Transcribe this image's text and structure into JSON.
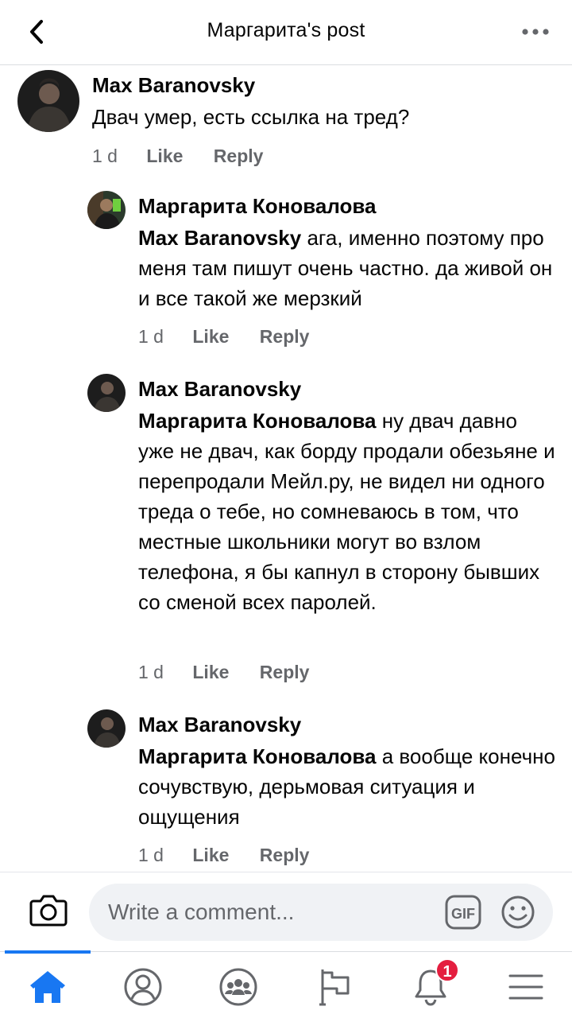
{
  "header": {
    "title": "Маргарита's post",
    "back_icon": "chevron-left-icon",
    "more_icon": "more-horizontal-icon"
  },
  "comments": [
    {
      "author": "Max Baranovsky",
      "mention": "",
      "text": "Двач умер, есть ссылка на тред?",
      "time": "1 d",
      "like": "Like",
      "reply": "Reply"
    },
    {
      "author": "Маргарита Коновалова",
      "mention": "Max Baranovsky",
      "text": " ага, именно поэтому про меня там пишут очень частно. да живой он и все такой же мерзкий",
      "time": "1 d",
      "like": "Like",
      "reply": "Reply"
    },
    {
      "author": "Max Baranovsky",
      "mention": "Маргарита Коновалова",
      "text": " ну двач давно уже не двач, как борду продали обезьяне и перепродали Мейл.ру, не видел ни одного треда о тебе, но сомневаюсь в том, что местные школьники могут во взлом телефона, я бы капнул в сторону бывших со сменой всех паролей.",
      "time": "1 d",
      "like": "Like",
      "reply": "Reply"
    },
    {
      "author": "Max Baranovsky",
      "mention": "Маргарита Коновалова",
      "text": " а вообще конечно сочувствую, дерьмовая ситуация и ощущения",
      "time": "1 d",
      "like": "Like",
      "reply": "Reply"
    }
  ],
  "composer": {
    "placeholder": "Write a comment...",
    "gif_label": "GIF"
  },
  "nav": {
    "items": [
      "home-icon",
      "profile-icon",
      "groups-icon",
      "pages-flag-icon",
      "notifications-bell-icon",
      "menu-icon"
    ],
    "active": "home-icon",
    "notification_count": "1"
  },
  "colors": {
    "accent": "#1877f2",
    "badge": "#e41e3f",
    "meta": "#65676b"
  }
}
